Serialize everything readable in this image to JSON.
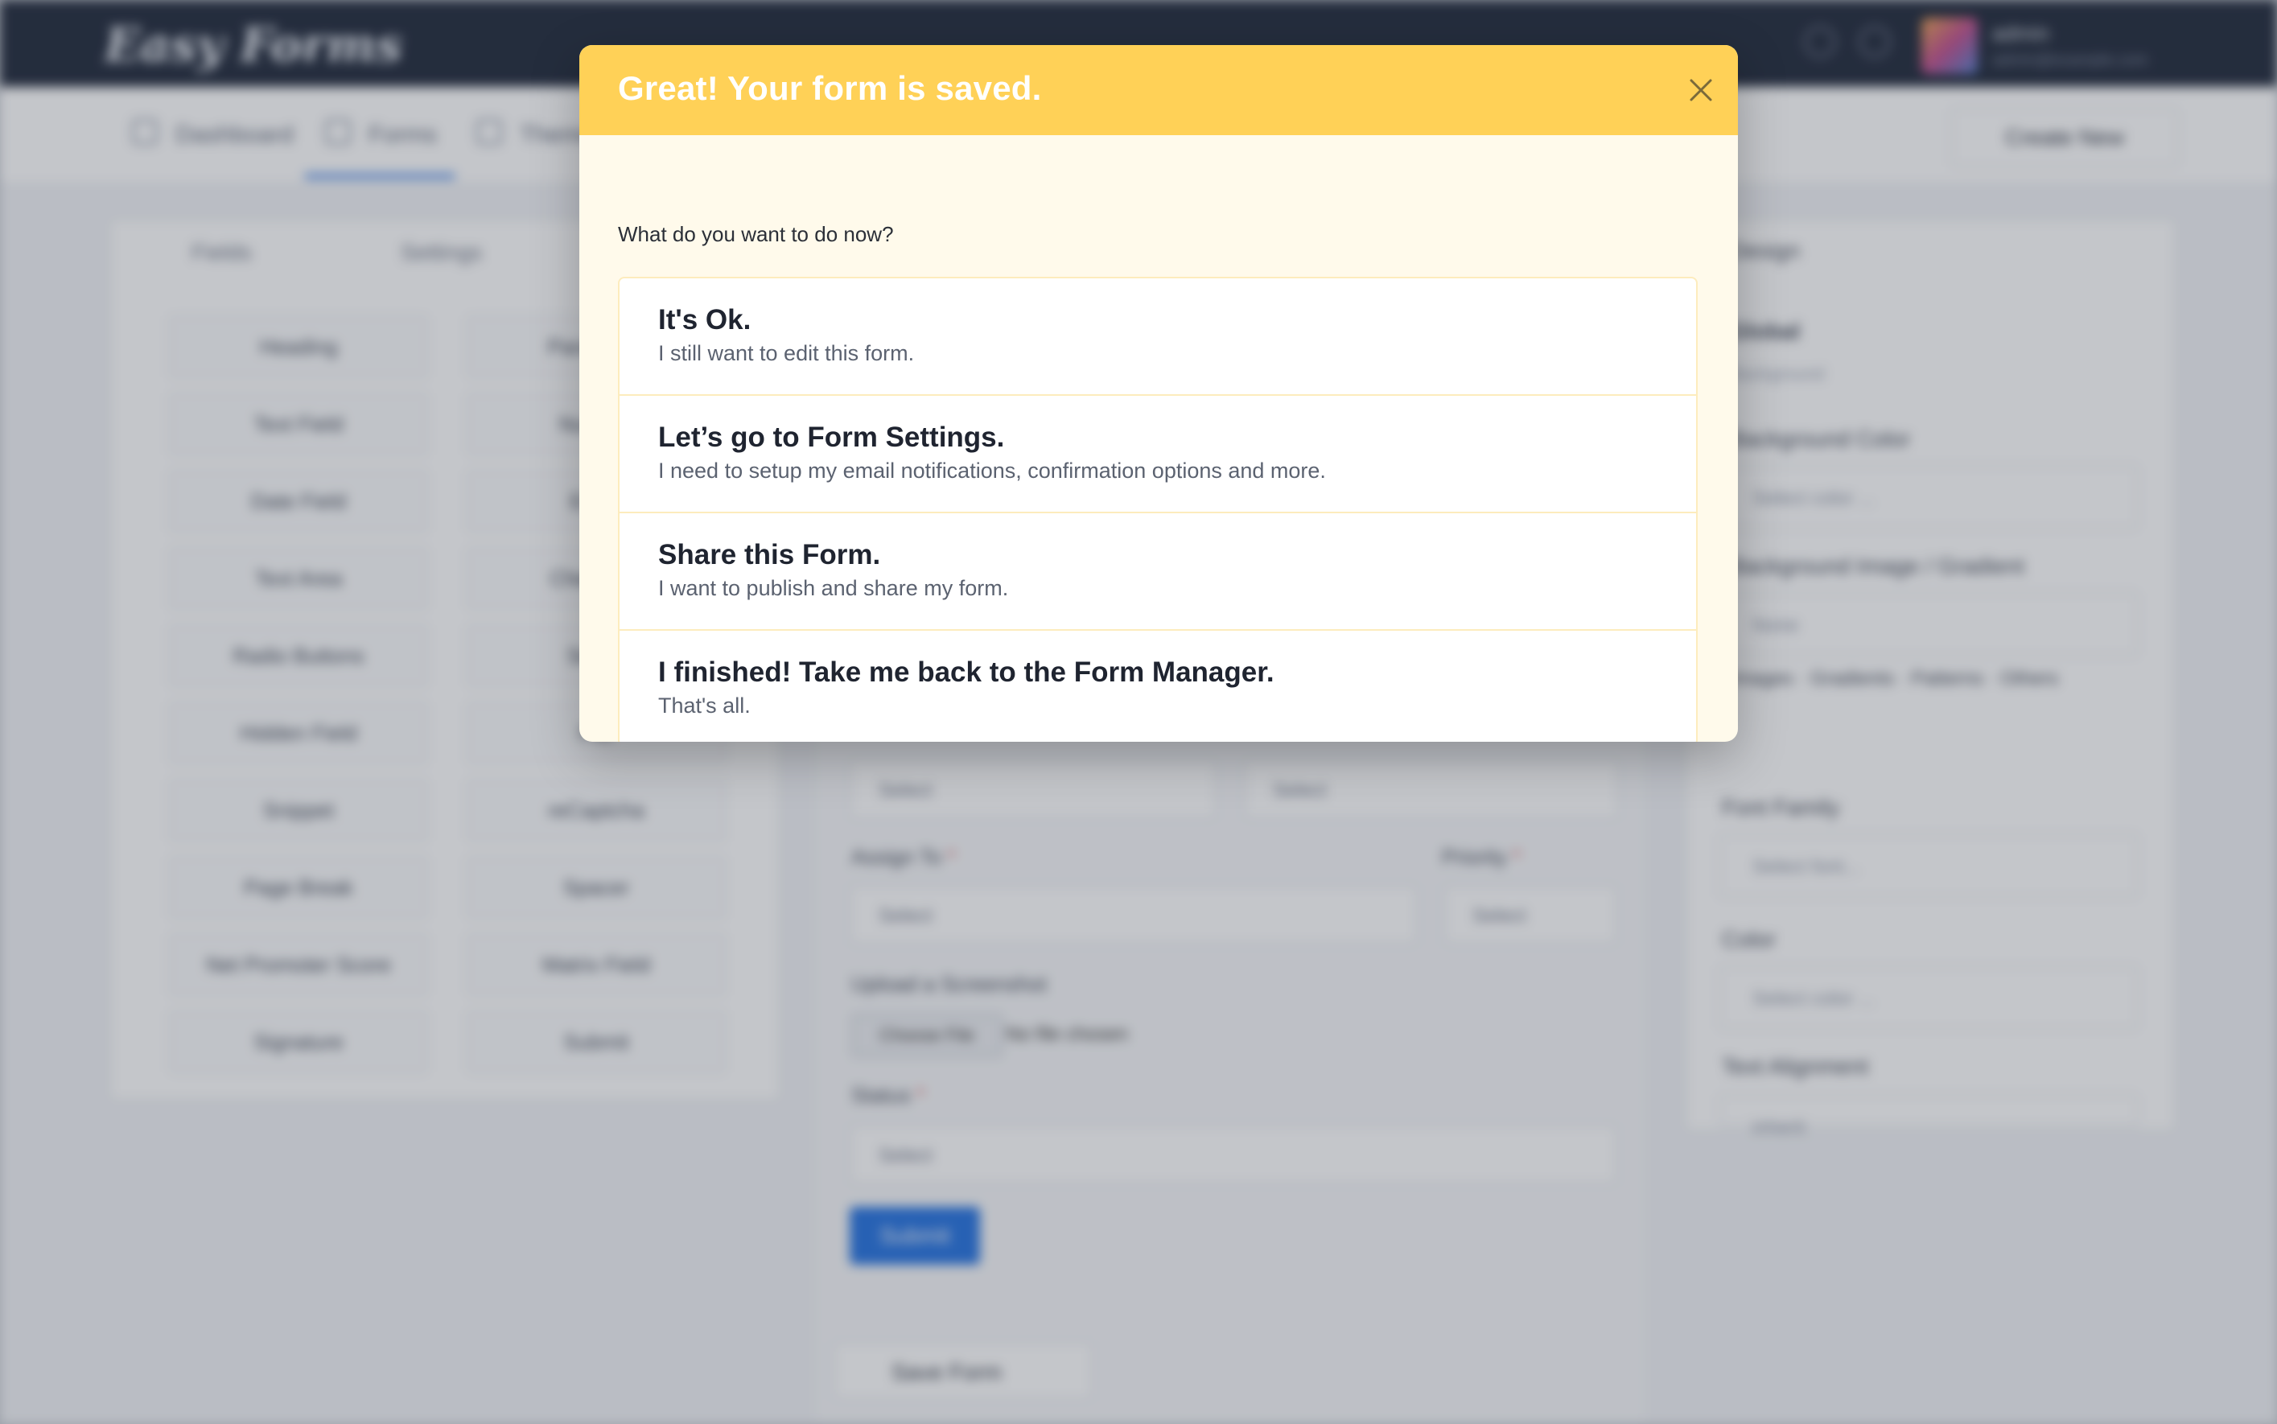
{
  "modal": {
    "title": "Great! Your form is saved.",
    "prompt": "What do you want to do now?",
    "options": [
      {
        "title": "It's Ok.",
        "description": "I still want to edit this form."
      },
      {
        "title": "Let’s go to Form Settings.",
        "description": "I need to setup my email notifications, confirmation options and more."
      },
      {
        "title": "Share this Form.",
        "description": "I want to publish and share my form."
      },
      {
        "title": "I finished! Take me back to the Form Manager.",
        "description": "That's all."
      }
    ],
    "colors": {
      "header": "#ffd157",
      "body": "#fffaeb"
    }
  },
  "background": {
    "logo": "Easy Forms",
    "user": {
      "name": "admin",
      "email": "admin@example.com"
    },
    "nav": [
      "Dashboard",
      "Forms",
      "Themes"
    ],
    "create_button": "Create New",
    "left_tabs": [
      "Fields",
      "Settings"
    ],
    "fields": [
      [
        "Heading",
        "Paragraph"
      ],
      [
        "Text Field",
        "Number"
      ],
      [
        "Date Field",
        "Email"
      ],
      [
        "Text Area",
        "Checkbox"
      ],
      [
        "Radio Buttons",
        "Select"
      ],
      [
        "Hidden Field",
        "File"
      ],
      [
        "Snippet",
        "reCaptcha"
      ],
      [
        "Page Break",
        "Spacer"
      ],
      [
        "Net Promoter Score",
        "Matrix Field"
      ],
      [
        "Signature",
        "Submit"
      ]
    ],
    "form": {
      "select_placeholder": "Select",
      "assign_label": "Assign To",
      "priority_label": "Priority",
      "upload_label": "Upload a Screenshot",
      "choose_file": "Choose File",
      "no_file": "No file chosen",
      "status_label": "Status",
      "submit": "Submit",
      "save_form": "Save Form"
    },
    "design": {
      "title": "Design",
      "global": "Global",
      "background_sub": "Background",
      "background_color": "Background Color",
      "select_color": "Select color ...",
      "background_image": "Background Image / Gradient",
      "none": "None",
      "image_tabs": "Images · Gradients · Patterns · Others",
      "font_family": "Font Family",
      "select_font": "Select font...",
      "color": "Color",
      "text_alignment": "Text Alignment",
      "inherit": "inherit"
    }
  }
}
